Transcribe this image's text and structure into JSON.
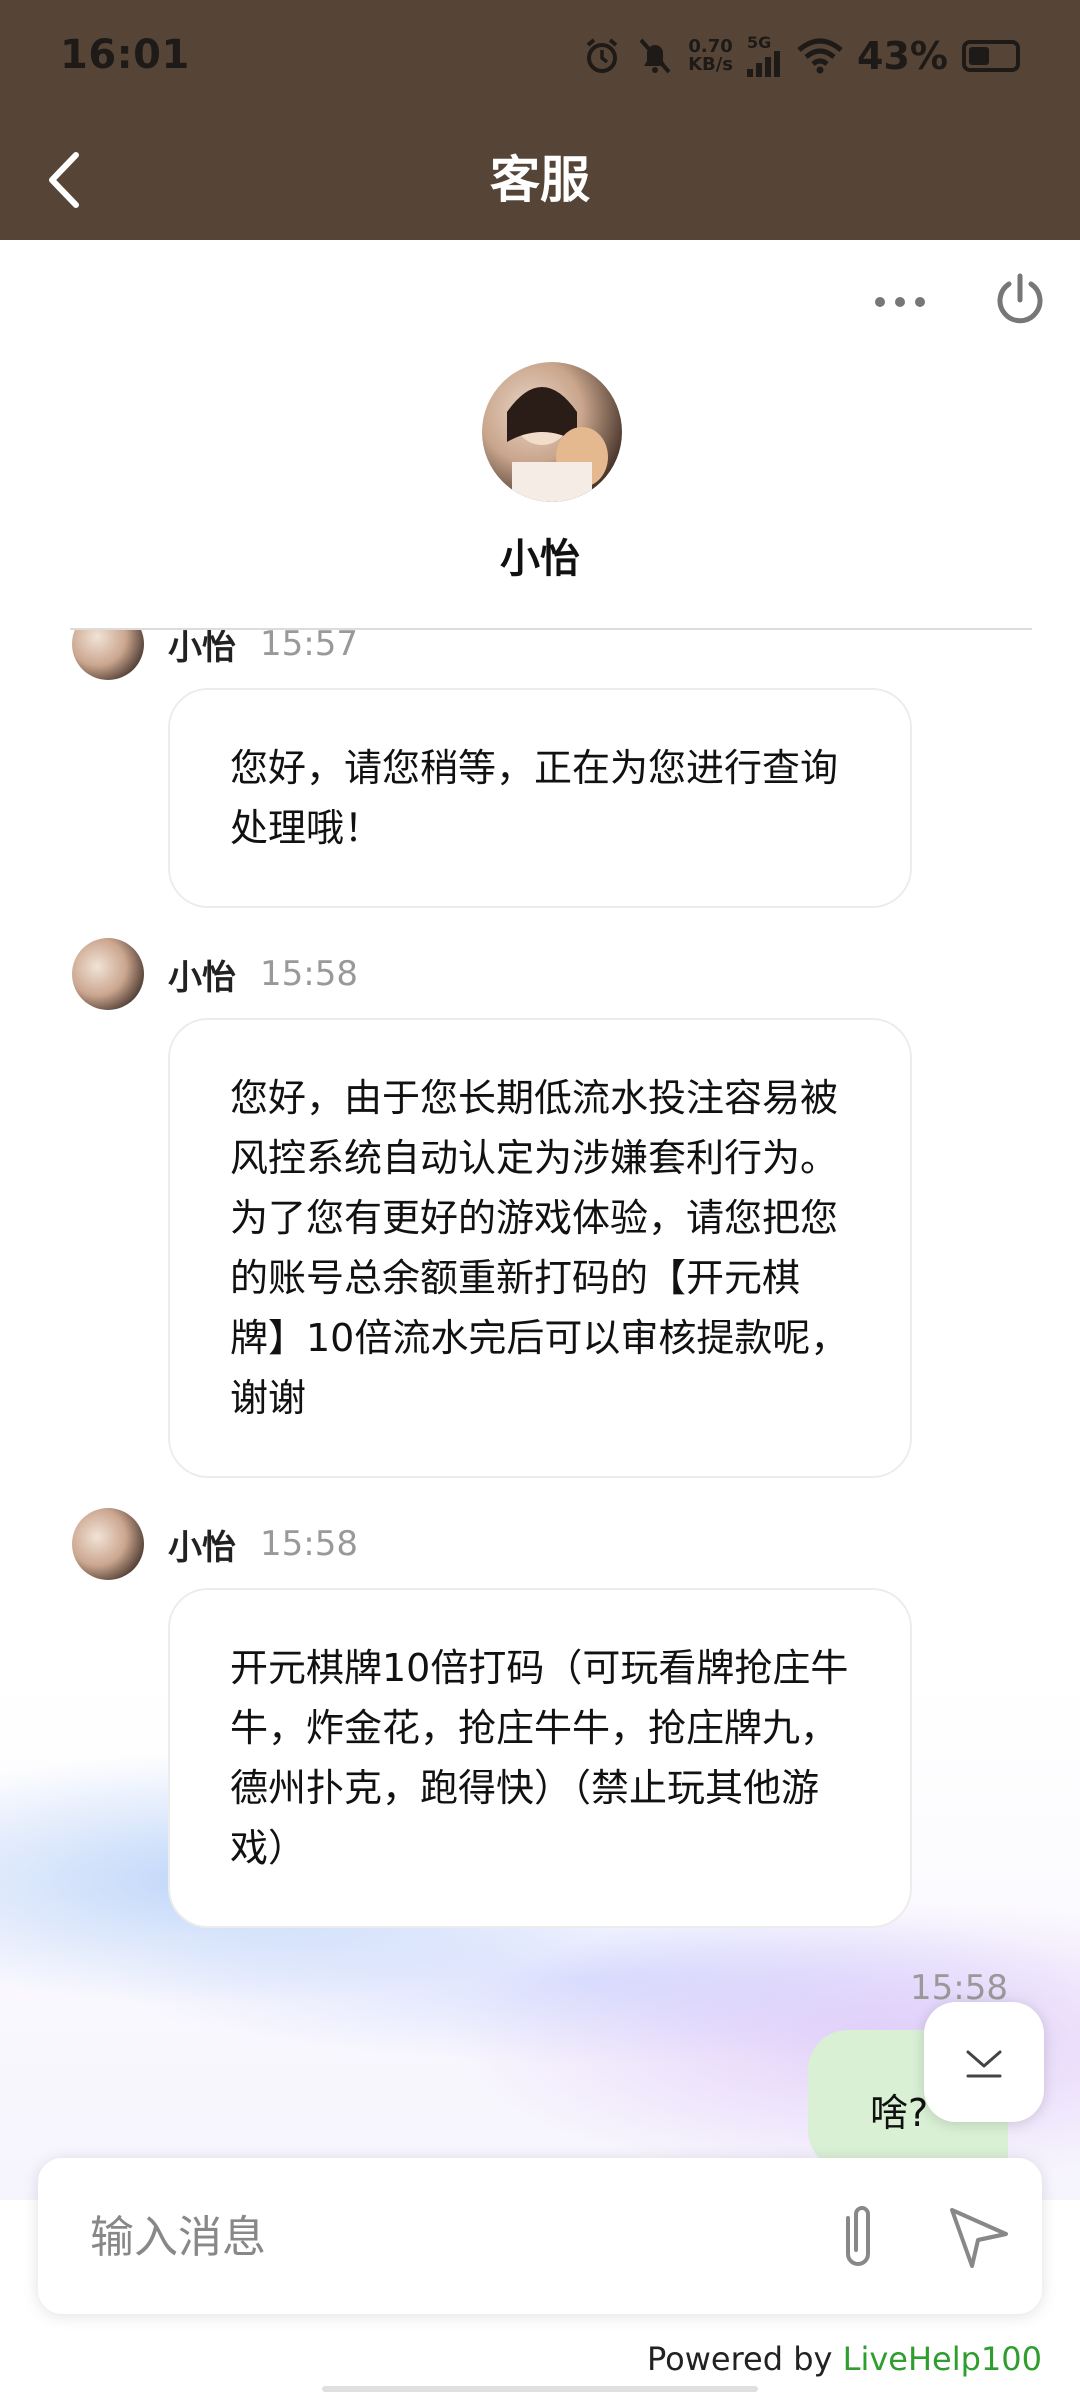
{
  "status_bar": {
    "time": "16:01",
    "net_speed_top": "0.70",
    "net_speed_bottom": "KB/s",
    "network": "5G",
    "battery": "43%"
  },
  "header": {
    "title": "客服"
  },
  "agent": {
    "name": "小怡"
  },
  "messages": [
    {
      "name": "小怡",
      "time": "15:57",
      "text": "您好，请您稍等，正在为您进行查询处理哦！"
    },
    {
      "name": "小怡",
      "time": "15:58",
      "text": "您好，由于您长期低流水投注容易被风控系统自动认定为涉嫌套利行为。为了您有更好的游戏体验，请您把您的账号总余额重新打码的【开元棋牌】10倍流水完后可以审核提款呢，谢谢"
    },
    {
      "name": "小怡",
      "time": "15:58",
      "text": "开元棋牌10倍打码（可玩看牌抢庄牛牛，炸金花，抢庄牛牛，抢庄牌九，德州扑克，跑得快）（禁止玩其他游戏）"
    }
  ],
  "my_message": {
    "time": "15:58",
    "text": "啥?"
  },
  "input": {
    "placeholder": "输入消息"
  },
  "footer": {
    "powered_prefix": "Powered by ",
    "powered_brand": "LiveHelp100"
  },
  "colors": {
    "topbar": "#564537",
    "my_bubble": "#d9f0d5",
    "brand": "#2f9e2f"
  }
}
